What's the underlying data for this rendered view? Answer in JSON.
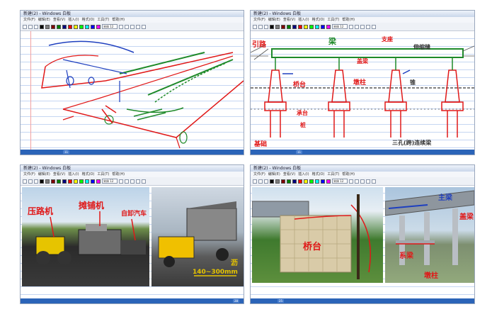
{
  "panels": [
    {
      "id": "tl",
      "title": "新建(2) - Windows 白板",
      "menu": [
        "文件(F)",
        "编辑(E)",
        "查看(V)",
        "插入(I)",
        "格式(O)",
        "工具(T)",
        "帮助(H)"
      ],
      "font_select": "宋体 12",
      "page": "11"
    },
    {
      "id": "tr",
      "title": "新建(2) - Windows 白板",
      "menu": [
        "文件(F)",
        "编辑(E)",
        "查看(V)",
        "插入(I)",
        "格式(O)",
        "工具(T)",
        "帮助(H)"
      ],
      "font_select": "宋体 12",
      "page": "11",
      "annotations": [
        "引路",
        "梁",
        "支座",
        "盖梁",
        "墩柱",
        "桥台",
        "承台",
        "桩",
        "基础",
        "三孔(跨)连续梁",
        "伸缩缝",
        "锥"
      ]
    },
    {
      "id": "bl",
      "title": "新建(2) - Windows 白板",
      "menu": [
        "文件(F)",
        "编辑(E)",
        "查看(V)",
        "插入(I)",
        "格式(O)",
        "工具(T)",
        "帮助(H)"
      ],
      "font_select": "宋体 12",
      "page": "28",
      "annotations": [
        "压路机",
        "摊铺机",
        "自卸汽车",
        "140~300mm",
        "沥"
      ]
    },
    {
      "id": "br",
      "title": "新建(2) - Windows 白板",
      "menu": [
        "文件(F)",
        "编辑(E)",
        "查看(V)",
        "插入(I)",
        "格式(O)",
        "工具(T)",
        "帮助(H)"
      ],
      "font_select": "宋体 12",
      "page": "25",
      "annotations": [
        "桥台",
        "主梁",
        "系梁",
        "墩柱",
        "盖梁"
      ]
    }
  ],
  "colors": {
    "ink_red": "#e01818",
    "ink_green": "#1f8a2a",
    "ink_blue": "#1e3fbf",
    "status_blue": "#2b64b8",
    "palette": [
      "#000000",
      "#7f7f7f",
      "#7f0000",
      "#7f7f00",
      "#007f00",
      "#007f7f",
      "#00007f",
      "#7f007f",
      "#ff0000",
      "#ffff00",
      "#00ff00",
      "#00ffff",
      "#0000ff",
      "#ff00ff",
      "#ffffff"
    ]
  },
  "icons": [
    "new-icon",
    "open-icon",
    "save-icon",
    "print-icon",
    "cut-icon",
    "copy-icon",
    "paste-icon",
    "undo-icon",
    "redo-icon",
    "pen-icon",
    "highlighter-icon",
    "eraser-icon",
    "select-icon"
  ]
}
